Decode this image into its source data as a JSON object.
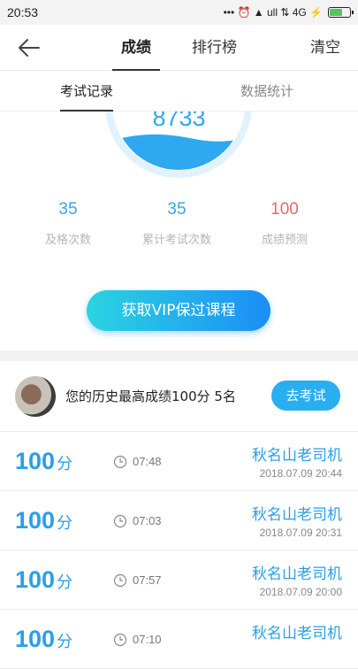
{
  "status_bar": {
    "time": "20:53",
    "icons_text": "••• ⏰ ▲ ull ⇅ 4G ⚡"
  },
  "header": {
    "tabs": [
      {
        "label": "成绩"
      },
      {
        "label": "排行榜"
      }
    ],
    "right_action": "清空"
  },
  "sub_tabs": [
    {
      "label": "考试记录"
    },
    {
      "label": "数据统计"
    }
  ],
  "gauge": {
    "value": "8733"
  },
  "stats": [
    {
      "value": "35",
      "label": "及格次数",
      "color": "#37a6e6"
    },
    {
      "value": "35",
      "label": "累计考试次数",
      "color": "#37a6e6"
    },
    {
      "value": "100",
      "label": "成绩预测",
      "color": "#e36b6b"
    }
  ],
  "vip_button": "获取VIP保过课程",
  "best": {
    "text": "您的历史最高成绩100分  5名",
    "button": "去考试"
  },
  "records": [
    {
      "score": "100",
      "unit": "分",
      "duration": "07:48",
      "name": "秋名山老司机",
      "date": "2018.07.09  20:44"
    },
    {
      "score": "100",
      "unit": "分",
      "duration": "07:03",
      "name": "秋名山老司机",
      "date": "2018.07.09  20:31"
    },
    {
      "score": "100",
      "unit": "分",
      "duration": "07:57",
      "name": "秋名山老司机",
      "date": "2018.07.09  20:00"
    },
    {
      "score": "100",
      "unit": "分",
      "duration": "07:10",
      "name": "秋名山老司机",
      "date": ""
    }
  ],
  "colors": {
    "accent": "#2a9fe6",
    "wave": "#2ea8f0",
    "gauge_ring": "#dff2fd"
  }
}
